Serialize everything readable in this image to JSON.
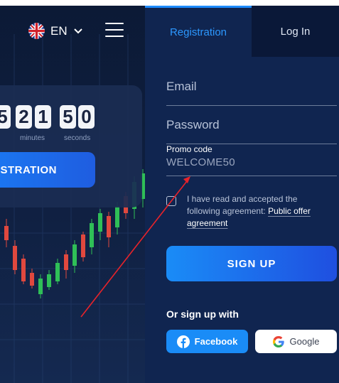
{
  "header": {
    "language": "EN",
    "language_icon": "uk-flag-icon",
    "menu_icon": "hamburger-menu-icon"
  },
  "timer": {
    "minutes_digits": [
      "2",
      "1"
    ],
    "seconds_digits": [
      "5",
      "0"
    ],
    "partial_digit": "5",
    "minutes_label": "minutes",
    "seconds_label": "seconds"
  },
  "hero": {
    "cta_label": "STRATION"
  },
  "tabs": {
    "registration": "Registration",
    "login": "Log In"
  },
  "form": {
    "email_placeholder": "Email",
    "password_placeholder": "Password",
    "promo_label": "Promo code",
    "promo_value": "WELCOME50",
    "agreement_text": "I have read and accepted the following agreement:",
    "agreement_link": "Public offer agreement",
    "signup_label": "SIGN UP",
    "or_text": "Or sign up with",
    "facebook_label": "Facebook",
    "google_label": "Google"
  },
  "colors": {
    "panel_bg": "#102550",
    "accent": "#1a8cf7",
    "tab_active_text": "#2c98ff",
    "annotation_arrow": "#e8232a"
  }
}
